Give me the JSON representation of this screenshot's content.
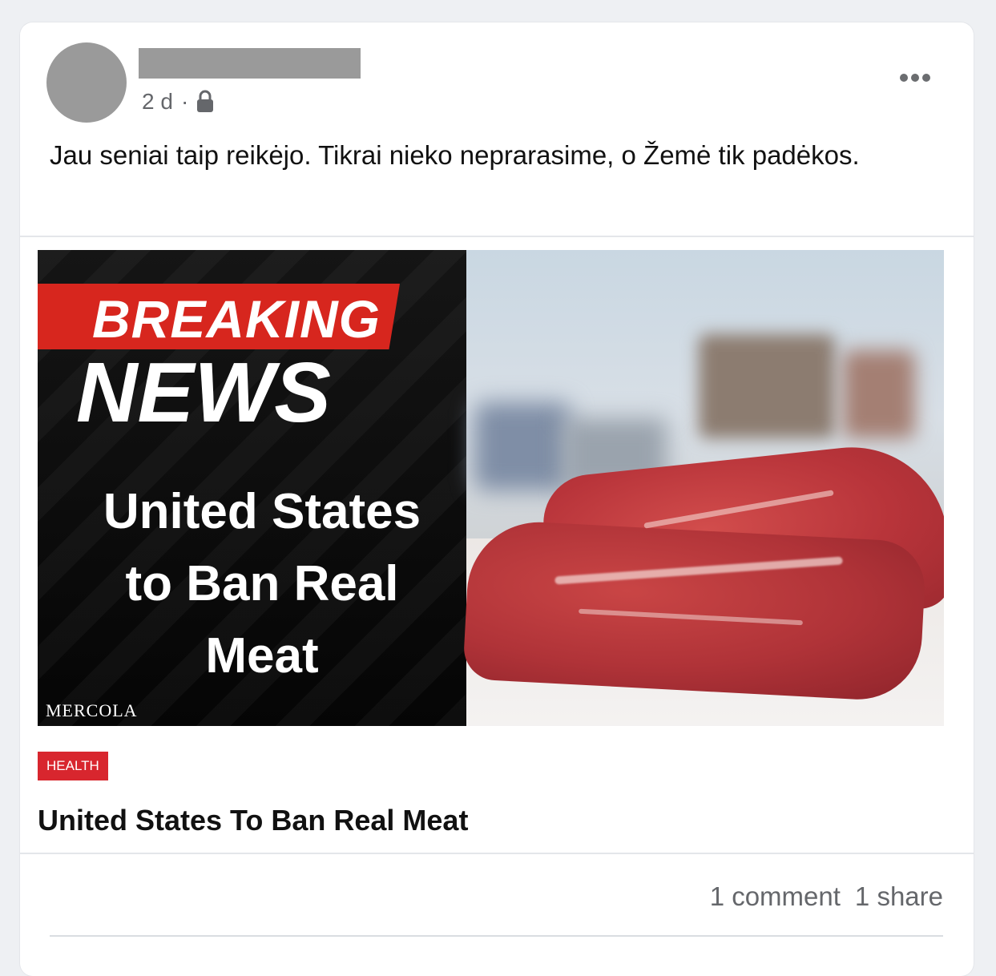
{
  "post": {
    "time": "2 d",
    "separator": "·",
    "privacy_icon": "lock-icon",
    "more_icon": "more-horizontal-icon",
    "text": "Jau seniai taip reikėjo. Tikrai nieko neprarasime, o Žemė tik padėkos."
  },
  "link_preview": {
    "image": {
      "breaking": "BREAKING",
      "news": "NEWS",
      "headline_line1": "United States",
      "headline_line2": "to Ban Real",
      "headline_line3": "Meat",
      "brand": "MERCOLA"
    },
    "tag": "HEALTH",
    "title": "United States To Ban Real Meat"
  },
  "stats": {
    "comments": "1 comment",
    "shares": "1 share"
  },
  "colors": {
    "tag_red": "#d8262e",
    "breaking_red": "#d7261e",
    "redaction_gray": "#9a9a9a"
  }
}
